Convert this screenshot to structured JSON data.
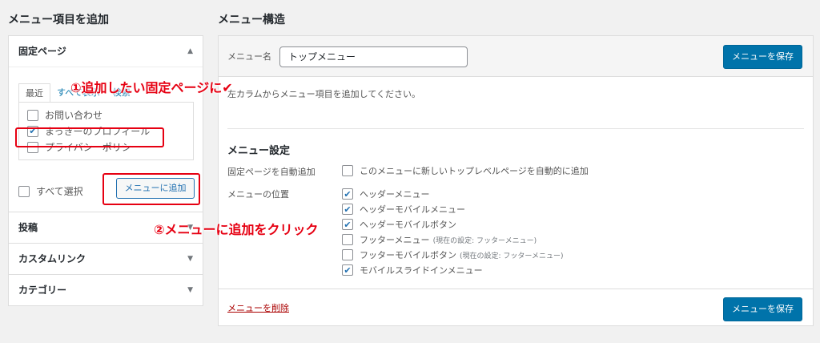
{
  "left": {
    "heading": "メニュー項目を追加",
    "pages_section": {
      "title": "固定ページ",
      "tabs": [
        "最近",
        "すべて表示",
        "検索"
      ],
      "items": [
        {
          "label": "お問い合わせ",
          "checked": false
        },
        {
          "label": "まっきーのプロフィール",
          "checked": true
        },
        {
          "label": "プライバシーポリシー",
          "checked": false
        }
      ],
      "select_all": "すべて選択",
      "add_button": "メニューに追加"
    },
    "sections": [
      "投稿",
      "カスタムリンク",
      "カテゴリー"
    ]
  },
  "right": {
    "heading": "メニュー構造",
    "menu_name_label": "メニュー名",
    "menu_name_value": "トップメニュー",
    "save_button": "メニューを保存",
    "instructions": "左カラムからメニュー項目を追加してください。",
    "settings_title": "メニュー設定",
    "auto_add_label": "固定ページを自動追加",
    "auto_add_option": "このメニューに新しいトップレベルページを自動的に追加",
    "location_label": "メニューの位置",
    "locations": [
      {
        "label": "ヘッダーメニュー",
        "checked": true,
        "note": ""
      },
      {
        "label": "ヘッダーモバイルメニュー",
        "checked": true,
        "note": ""
      },
      {
        "label": "ヘッダーモバイルボタン",
        "checked": true,
        "note": ""
      },
      {
        "label": "フッターメニュー",
        "checked": false,
        "note": "(現在の設定: フッターメニュー)"
      },
      {
        "label": "フッターモバイルボタン",
        "checked": false,
        "note": "(現在の設定: フッターメニュー)"
      },
      {
        "label": "モバイルスライドインメニュー",
        "checked": true,
        "note": ""
      }
    ],
    "delete_link": "メニューを削除"
  },
  "annotations": {
    "step1": "①追加したい固定ページに✔",
    "step2": "②メニューに追加をクリック"
  },
  "colors": {
    "accent": "#0073aa",
    "annotation": "#e60012",
    "delete": "#aa0000"
  }
}
